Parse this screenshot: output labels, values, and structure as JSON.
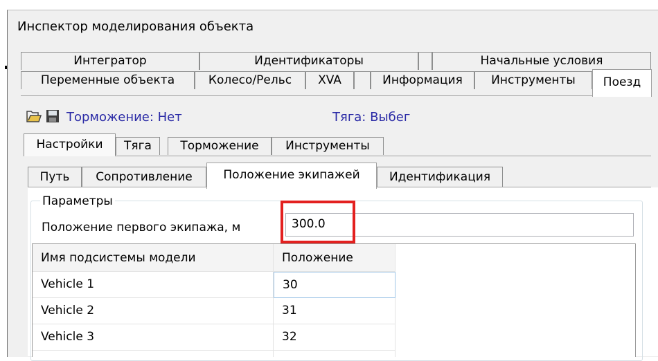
{
  "window": {
    "title": "Инспектор моделирования объекта"
  },
  "tabs_row1": [
    {
      "label": "Интегратор"
    },
    {
      "label": "Идентификаторы"
    },
    {
      "label": "Начальные условия"
    }
  ],
  "tabs_row2": [
    {
      "label": "Переменные объекта"
    },
    {
      "label": "Колесо/Рельс"
    },
    {
      "label": "XVA"
    },
    {
      "label": "Информация"
    },
    {
      "label": "Инструменты"
    },
    {
      "label": "Поезд",
      "active": true
    }
  ],
  "toolbar": {
    "icons": [
      "open-folder-icon",
      "save-icon"
    ],
    "braking_status": "Торможение: Нет",
    "traction_status": "Тяга: Выбег"
  },
  "subtabs": [
    {
      "label": "Настройки",
      "active": true
    },
    {
      "label": "Тяга"
    },
    {
      "label": "Торможение"
    },
    {
      "label": "Инструменты"
    }
  ],
  "innertabs": [
    {
      "label": "Путь"
    },
    {
      "label": "Сопротивление"
    },
    {
      "label": "Положение экипажей",
      "active": true
    },
    {
      "label": "Идентификация"
    }
  ],
  "params": {
    "group_label": "Параметры",
    "first_vehicle_label": "Положение первого экипажа, м",
    "first_vehicle_value": "300.0"
  },
  "table": {
    "headers": [
      "Имя подсистемы модели",
      "Положение"
    ],
    "rows": [
      {
        "name": "Vehicle 1",
        "position": "30"
      },
      {
        "name": "Vehicle 2",
        "position": "31"
      },
      {
        "name": "Vehicle 3",
        "position": "32"
      }
    ]
  },
  "colors": {
    "highlight": "#e3201f",
    "status_text": "#2a2aa6"
  }
}
